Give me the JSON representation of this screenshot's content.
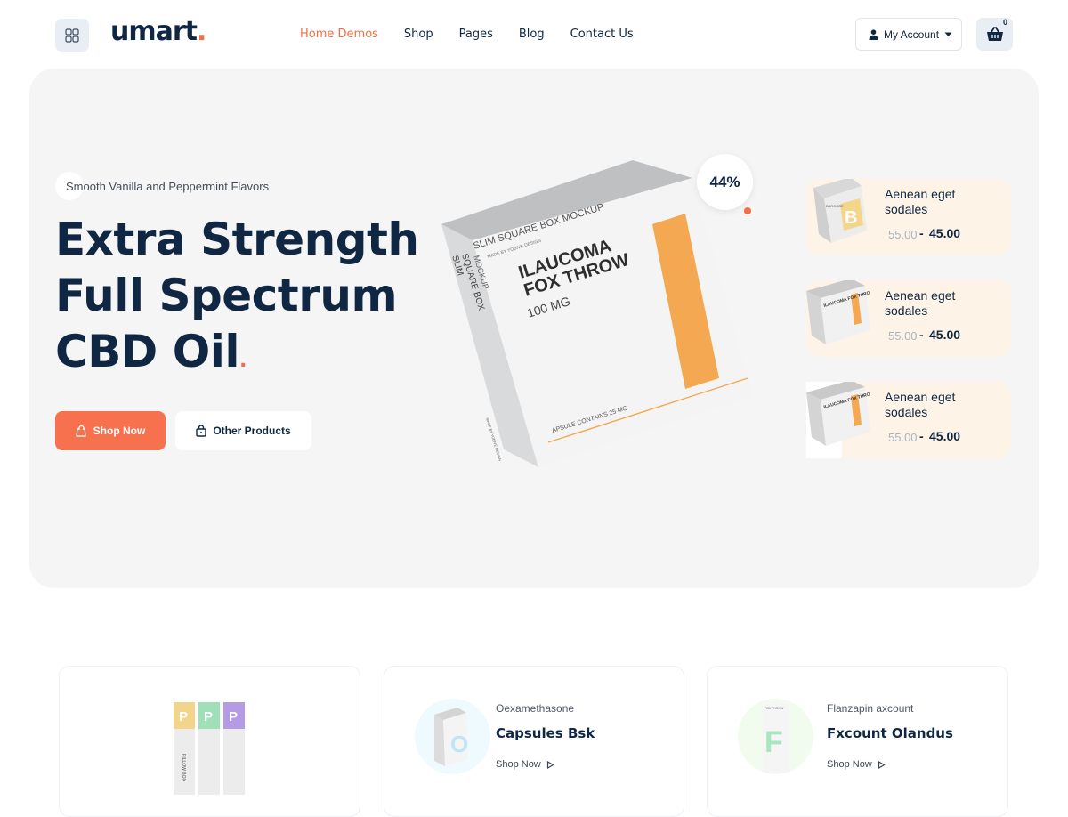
{
  "header": {
    "logo": "umart",
    "logo_dot": ".",
    "nav": [
      "Home Demos",
      "Shop",
      "Pages",
      "Blog",
      "Contact Us"
    ],
    "account_label": "My Account",
    "cart_count": "0"
  },
  "hero": {
    "tagline": "Smooth Vanilla and Peppermint Flavors",
    "headline_lines": [
      "Extra Strength",
      "Full Spectrum",
      "CBD Oil"
    ],
    "headline_dot": ".",
    "shop_button": "Shop Now",
    "other_button": "Other Products",
    "discount": "44%",
    "box_text": {
      "top": "SLIM SQUARE BOX MOCKUP",
      "made": "MADE BY YOBIVE DESIGN",
      "side1": "SLIM",
      "side2": "SQUARE BOX",
      "side3": "MOCKUP",
      "brand1": "ILAUCOMA",
      "brand2": "FOX THROW",
      "dose": "100 MG",
      "capsules": "APSULE CONTAINS 25 MG",
      "design_by": "MADE BY YOBIVE DESIGN"
    }
  },
  "side_products": [
    {
      "name": "Aenean eget sodales",
      "old_price": "55.00",
      "separator": "-",
      "new_price": "45.00",
      "thumb_letter": "B",
      "thumb_label": "BARCODE"
    },
    {
      "name": "Aenean eget sodales",
      "old_price": "55.00",
      "separator": "-",
      "new_price": "45.00",
      "thumb_letter": "",
      "thumb_label": "ILAUCOMA FOX THROW"
    },
    {
      "name": "Aenean eget sodales",
      "old_price": "55.00",
      "separator": "-",
      "new_price": "45.00",
      "thumb_letter": "",
      "thumb_label": "ILAUCOMA FOX THROW"
    }
  ],
  "categories": [
    {
      "subtitle": "",
      "title": "",
      "link": "",
      "thumb_letters": [
        "P",
        "P",
        "P"
      ],
      "thumb_label": "PILLOW BOX"
    },
    {
      "subtitle": "Oexamethasone",
      "title": "Capsules Bsk",
      "link": "Shop Now",
      "thumb_letter": "O"
    },
    {
      "subtitle": "Flanzapin axcount",
      "title": "Fxcount Olandus",
      "link": "Shop Now",
      "thumb_letter": "F",
      "thumb_label": "FOX THROW"
    }
  ],
  "colors": {
    "accent": "#f46e43",
    "navy": "#0f2742",
    "hero_bg": "#f5f5f5",
    "card_bg": "#fdf3e6",
    "box_orange": "#f3a851"
  }
}
